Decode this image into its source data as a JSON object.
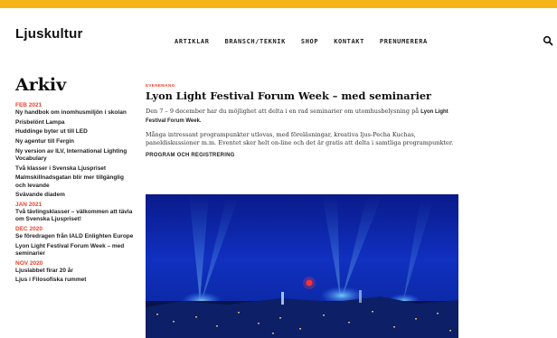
{
  "site": {
    "logo": "Ljuskultur"
  },
  "nav": [
    "ARTIKLAR",
    "BRANSCH/TEKNIK",
    "SHOP",
    "KONTAKT",
    "PRENUMERERA"
  ],
  "icons": {
    "search": "search-icon"
  },
  "colors": {
    "frame": "#f5b418",
    "accent": "#e8442e",
    "text": "#222222"
  },
  "sidebar": {
    "title": "Arkiv",
    "groups": [
      {
        "month": "FEB 2021",
        "items": [
          "Ny handbok om inomhusmiljön i skolan",
          "Prisbelönt Lampa",
          "Huddinge byter ut till LED",
          "Ny agentur till Fergin",
          "Ny version av ILV, International Lighting Vocabulary",
          "Två klasser i Svenska Ljuspriset",
          "Malmskillnadsgatan blir mer tillgänglig och levande",
          "Svävande diadem"
        ]
      },
      {
        "month": "JAN 2021",
        "items": [
          "Två tävlingsklasser – välkommen att tävla om Svenska Ljuspriset!"
        ]
      },
      {
        "month": "DEC 2020",
        "items": [
          "Se föredragen från IALD Enlighten Europe",
          "Lyon Light Festival Forum Week – med seminarier"
        ]
      },
      {
        "month": "NOV 2020",
        "items": [
          "Ljuslabbet firar 20 år",
          "Ljus i Filosofiska rummet"
        ]
      }
    ]
  },
  "article": {
    "kicker": "EVENEMANG",
    "title": "Lyon Light Festival Forum Week – med seminarier",
    "intro": "Den 7 – 9 december har du möjlighet att delta i en rad seminarier om utomhusbelysning på",
    "intro_bold": "Lyon Light Festival Forum Week.",
    "body": "Många intressant programpunkter utlovas, med föreläsningar, kreativa ljus-Pecha Kuchas, paneldiskussioner m.m. Eventet sker helt on-line och det är gratis att delta i samtliga programpunkter.",
    "program_heading": "PROGRAM OCH REGISTRERING",
    "image": "night-city-light-festival-photo"
  }
}
